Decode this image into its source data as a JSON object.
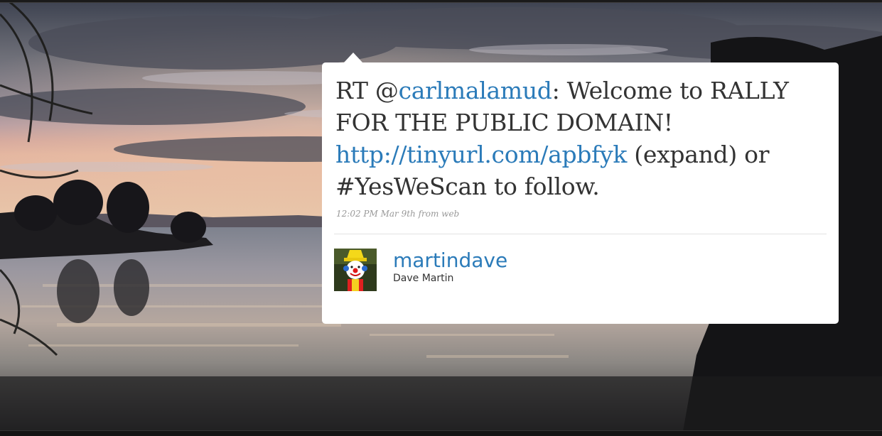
{
  "tweet": {
    "prefix": "RT @",
    "mention": "carlmalamud",
    "text_part1": ": Welcome to RALLY FOR THE PUBLIC DOMAIN! ",
    "link": "http://tinyurl.com/apbfyk",
    "expand_label": " (expand) or",
    "hashtag": "#YesWeScan",
    "text_part2": " to follow.",
    "timestamp": "12:02 PM Mar 9th",
    "source": "from web"
  },
  "author": {
    "screen_name": "martindave",
    "full_name": "Dave Martin",
    "avatar_icon": "clown-avatar-icon"
  },
  "colors": {
    "link": "#2b7bb9",
    "text": "#333333",
    "meta": "#999999",
    "card": "#ffffff"
  }
}
